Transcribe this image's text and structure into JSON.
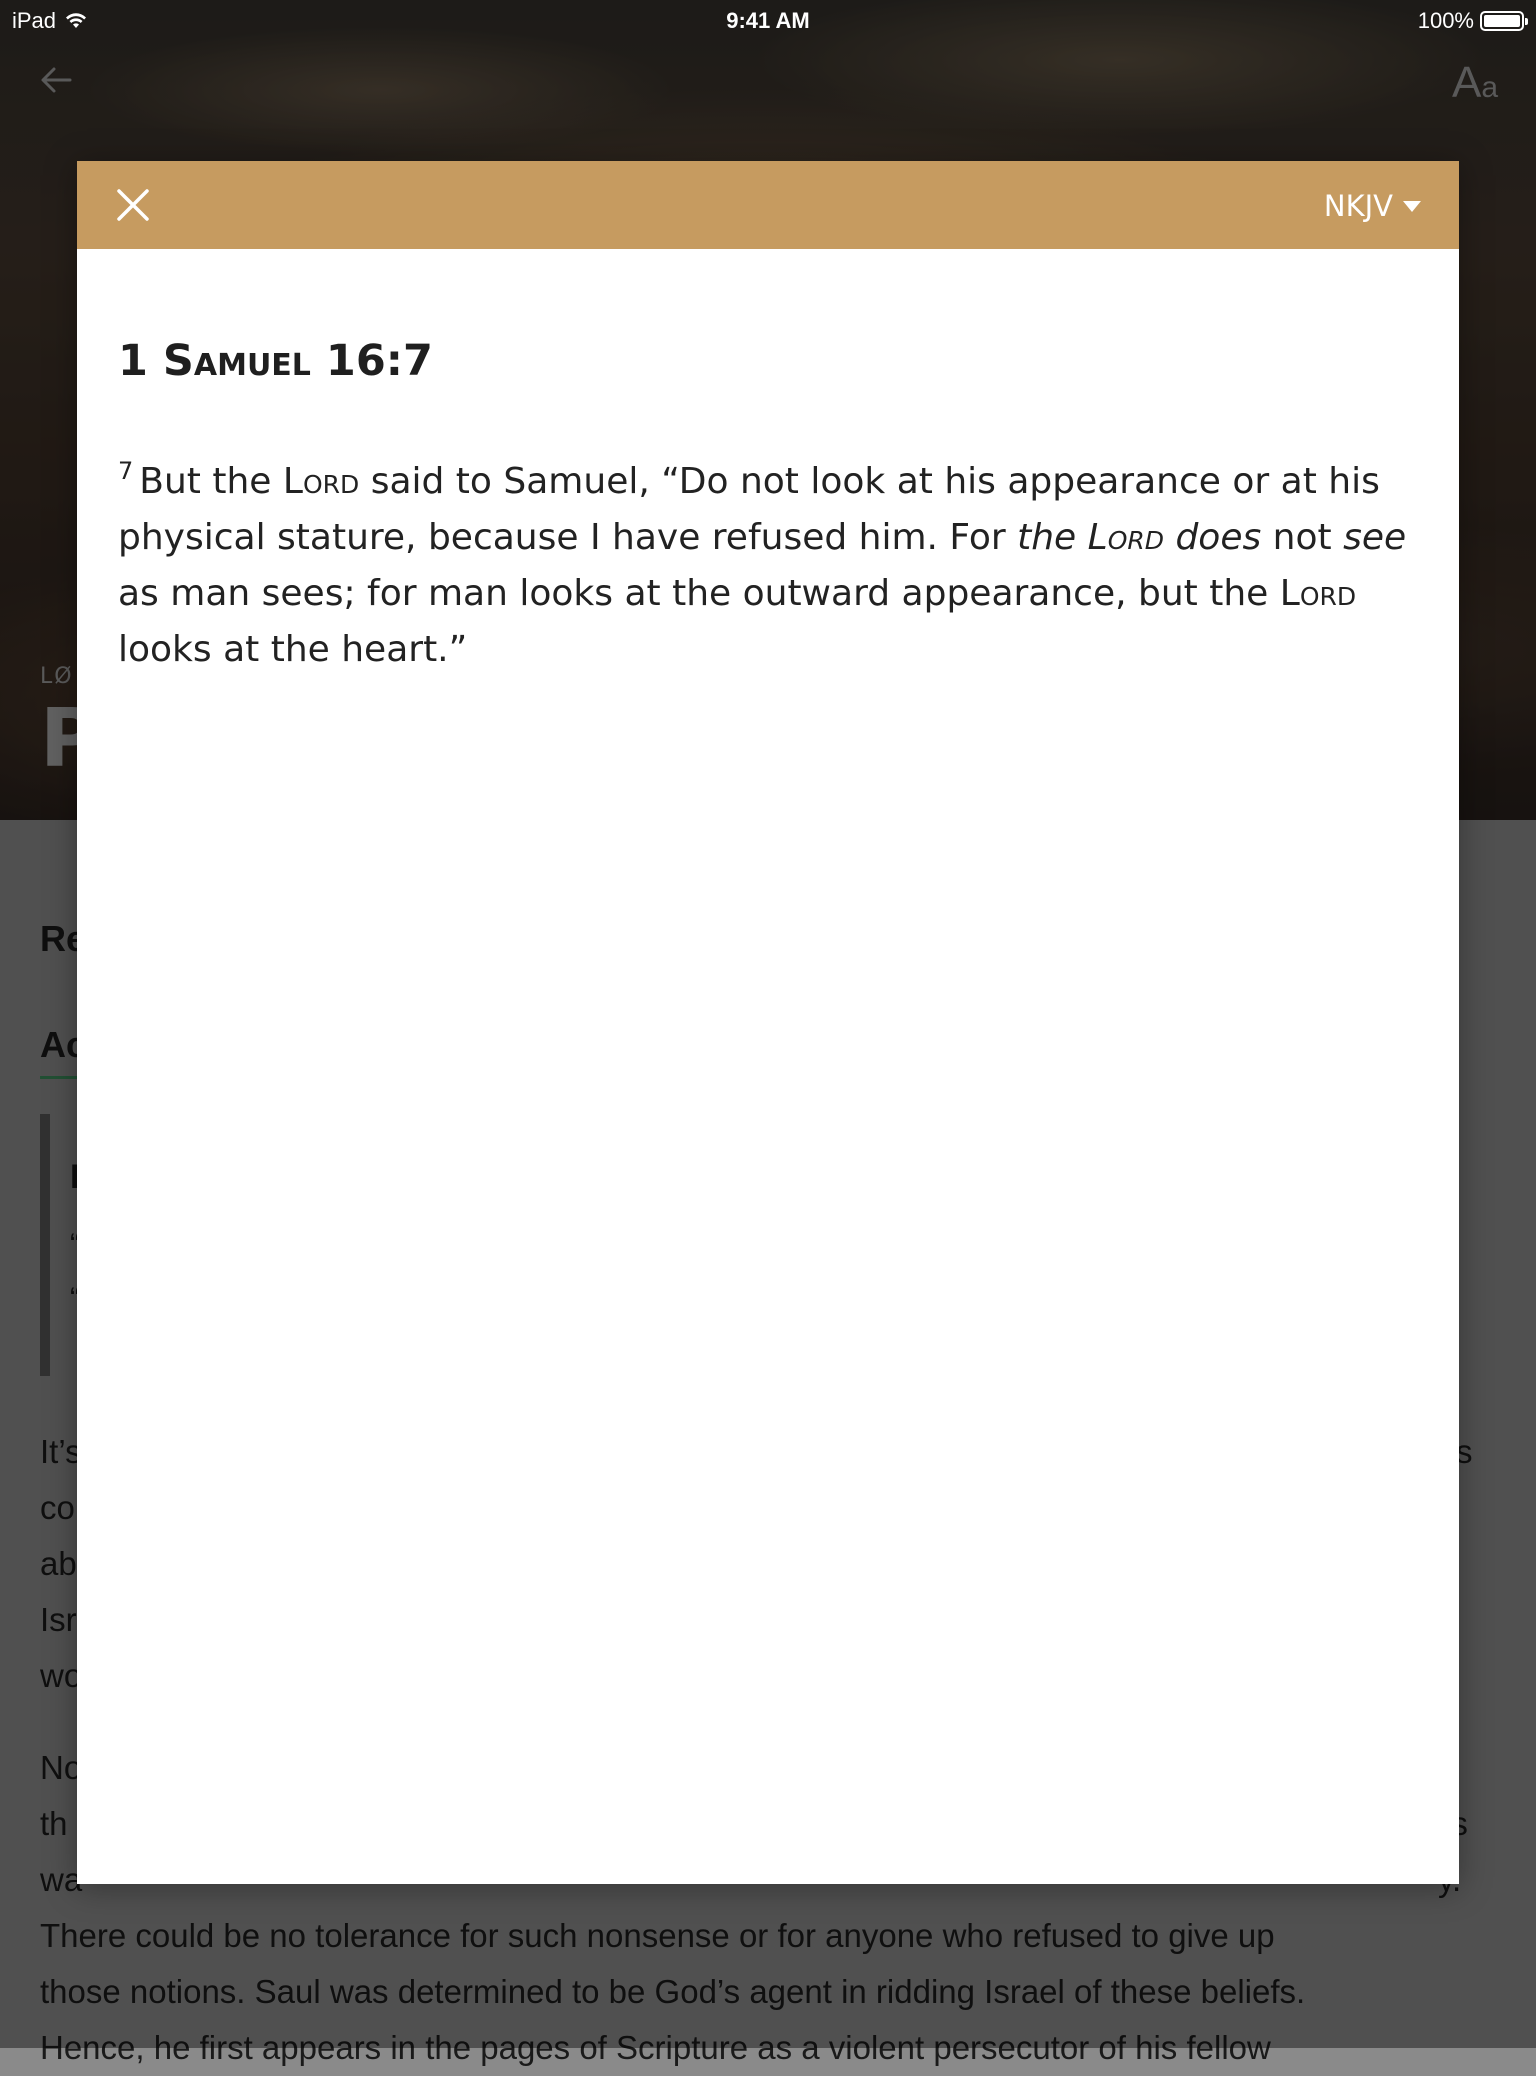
{
  "status_bar": {
    "device": "iPad",
    "time": "9:41 AM",
    "battery": "100%"
  },
  "nav": {
    "back_icon": "arrow-left-icon",
    "font_size_big": "A",
    "font_size_small": "a"
  },
  "background_lesson": {
    "label": "LØ",
    "title": "P",
    "heading1": "Re",
    "heading2": "Ac",
    "quote_line1": "I",
    "quote_line2": "“",
    "quote_line3": "“",
    "para_lines": [
      "It’s",
      "co",
      "ab",
      "Isr",
      "wo",
      "No",
      "th",
      "wa",
      "There could be no tolerance for such nonsense or for anyone who refused to give up",
      "those notions. Saul was determined to be God’s agent in ridding Israel of these beliefs.",
      "Hence, he first appears in the pages of Scripture as a violent persecutor of his fellow"
    ],
    "right_edge_1": "s",
    "right_edge_2": "is",
    "right_edge_3": "y."
  },
  "modal": {
    "header_color": "#c69b60",
    "close_icon": "close-icon",
    "version": "NKJV",
    "reference_book_num": "1",
    "reference_book": "Samuel",
    "reference_verse": "16:7",
    "verse_number": "7",
    "verse_parts": {
      "p1": "But the ",
      "lord1": "Lord",
      "p2": " said to Samuel, “Do not look at his appearance or at his physical stature, because I have refused him. For ",
      "i1": "the ",
      "lord2": "Lord",
      "i2": " does",
      "p3": " not ",
      "i3": "see",
      "p4": " as man sees; for man looks at the outward appearance, but the ",
      "lord3": "Lord",
      "p5": " looks at the heart.”"
    }
  }
}
